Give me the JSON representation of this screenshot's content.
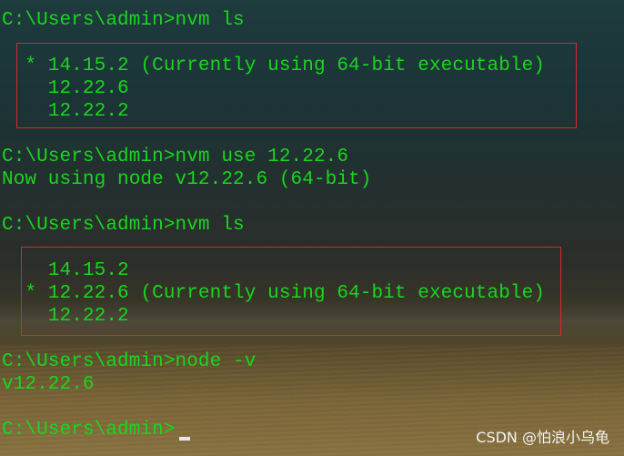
{
  "terminal": {
    "lines": [
      "C:\\Users\\admin>nvm ls",
      "",
      "  * 14.15.2 (Currently using 64-bit executable)",
      "    12.22.6",
      "    12.22.2",
      "",
      "C:\\Users\\admin>nvm use 12.22.6",
      "Now using node v12.22.6 (64-bit)",
      "",
      "C:\\Users\\admin>nvm ls",
      "",
      "    14.15.2",
      "  * 12.22.6 (Currently using 64-bit executable)",
      "    12.22.2",
      "",
      "C:\\Users\\admin>node -v",
      "v12.22.6",
      "",
      "C:\\Users\\admin>"
    ]
  },
  "colors": {
    "text": "#19d61d",
    "highlight_box": "#d8292b",
    "cursor": "#e8e8e8"
  },
  "watermark": "CSDN @怕浪小乌龟"
}
